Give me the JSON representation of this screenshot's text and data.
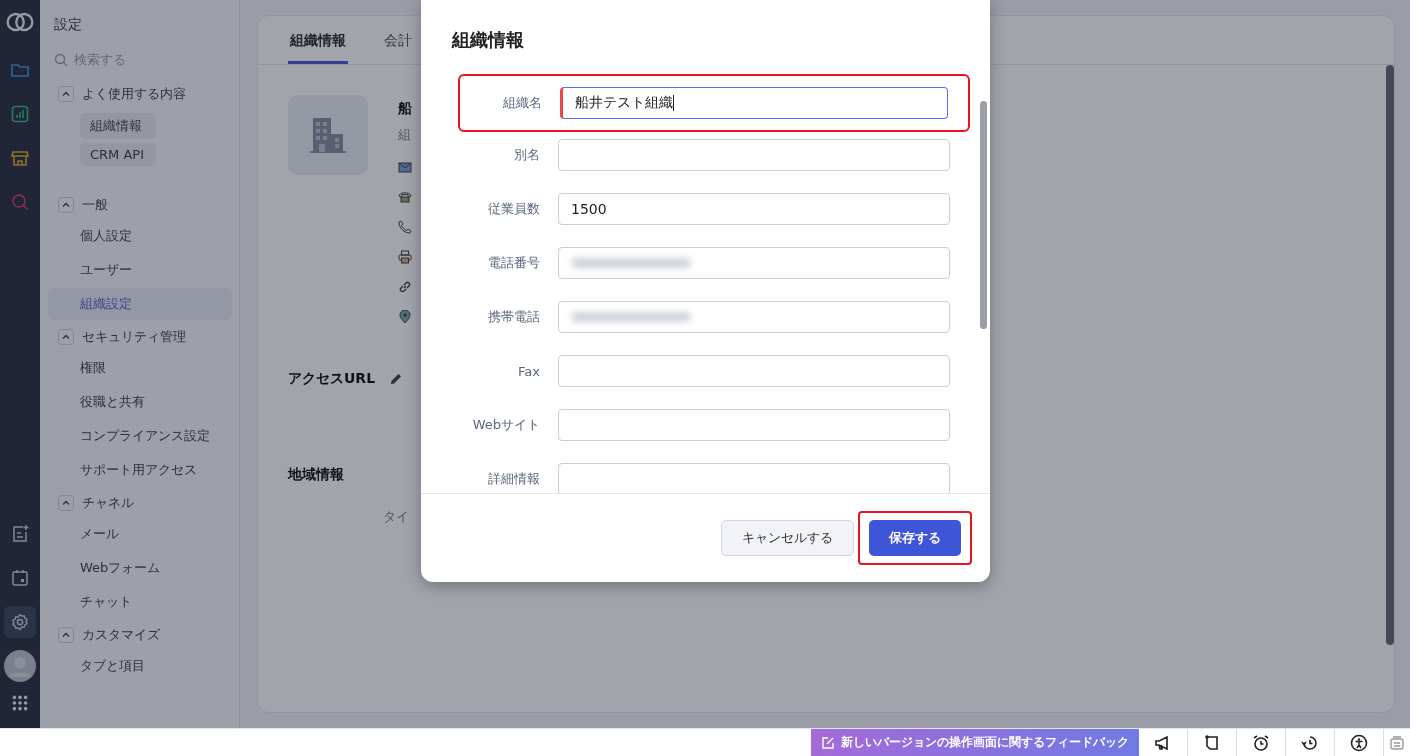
{
  "rail": [
    {
      "kind": "folder",
      "selected": false
    },
    {
      "kind": "chart",
      "selected": false
    },
    {
      "kind": "store",
      "selected": false
    },
    {
      "kind": "search",
      "selected": false
    },
    {
      "kind": "note",
      "selected": false
    },
    {
      "kind": "calendar",
      "selected": false
    },
    {
      "kind": "settings",
      "selected": true
    }
  ],
  "sidebar": {
    "title": "設定",
    "search": {
      "placeholder": "検索する"
    },
    "groups": [
      {
        "label": "よく使用する内容",
        "expanded": true,
        "kind": "chips",
        "items": [
          {
            "label": "組織情報",
            "selected": false
          },
          {
            "label": "CRM API",
            "selected": false
          }
        ]
      },
      {
        "label": "一般",
        "expanded": true,
        "kind": "list",
        "items": [
          {
            "label": "個人設定",
            "selected": false
          },
          {
            "label": "ユーザー",
            "selected": false
          },
          {
            "label": "組織設定",
            "selected": true
          }
        ]
      },
      {
        "label": "セキュリティ管理",
        "expanded": true,
        "kind": "list",
        "items": [
          {
            "label": "権限",
            "selected": false
          },
          {
            "label": "役職と共有",
            "selected": false
          },
          {
            "label": "コンプライアンス設定",
            "selected": false
          },
          {
            "label": "サポート用アクセス",
            "selected": false
          }
        ]
      },
      {
        "label": "チャネル",
        "expanded": true,
        "kind": "list",
        "items": [
          {
            "label": "メール",
            "selected": false
          },
          {
            "label": "Webフォーム",
            "selected": false
          },
          {
            "label": "チャット",
            "selected": false
          }
        ]
      },
      {
        "label": "カスタマイズ",
        "expanded": true,
        "kind": "list",
        "items": [
          {
            "label": "タブと項目",
            "selected": false
          }
        ]
      }
    ]
  },
  "main": {
    "tabs": [
      {
        "label": "組織情報",
        "selected": true
      },
      {
        "label": "会計",
        "selected": false
      }
    ],
    "org_name": "船",
    "org_subtitle": "組",
    "contacts": [
      {
        "kind": "mail"
      },
      {
        "kind": "phone"
      },
      {
        "kind": "mobile"
      },
      {
        "kind": "printer"
      },
      {
        "kind": "link"
      },
      {
        "kind": "pin"
      }
    ],
    "access_url": "アクセスURL",
    "region": "地域情報",
    "timezone": "タイ"
  },
  "dialog": {
    "title": "組織情報",
    "fields": [
      {
        "label": "組織名",
        "kind": "text",
        "value": "船井テスト組織",
        "required": true,
        "focused": true,
        "highlighted": true
      },
      {
        "label": "別名",
        "kind": "text",
        "required": false,
        "focused": false,
        "highlighted": false
      },
      {
        "label": "従業員数",
        "kind": "text",
        "value": "1500",
        "required": false,
        "focused": false,
        "highlighted": false
      },
      {
        "label": "電話番号",
        "kind": "redacted",
        "required": false,
        "focused": false,
        "highlighted": false
      },
      {
        "label": "携帯電話",
        "kind": "redacted",
        "required": false,
        "focused": false,
        "highlighted": false
      },
      {
        "label": "Fax",
        "kind": "text",
        "required": false,
        "focused": false,
        "highlighted": false
      },
      {
        "label": "Webサイト",
        "kind": "text",
        "required": false,
        "focused": false,
        "highlighted": false
      },
      {
        "label": "詳細情報",
        "kind": "text",
        "required": false,
        "focused": false,
        "highlighted": false
      }
    ],
    "cancel_button": {
      "label": "キャンセルする",
      "highlighted": false
    },
    "save_button": {
      "label": "保存する",
      "highlighted": true
    }
  },
  "bottom_bar": {
    "feedback": "新しいバージョンの操作画面に関するフィードバック",
    "icons": [
      {
        "kind": "megaphone"
      },
      {
        "kind": "note"
      },
      {
        "kind": "alarm"
      },
      {
        "kind": "history"
      },
      {
        "kind": "accessibility"
      },
      {
        "kind": "stack"
      }
    ]
  }
}
